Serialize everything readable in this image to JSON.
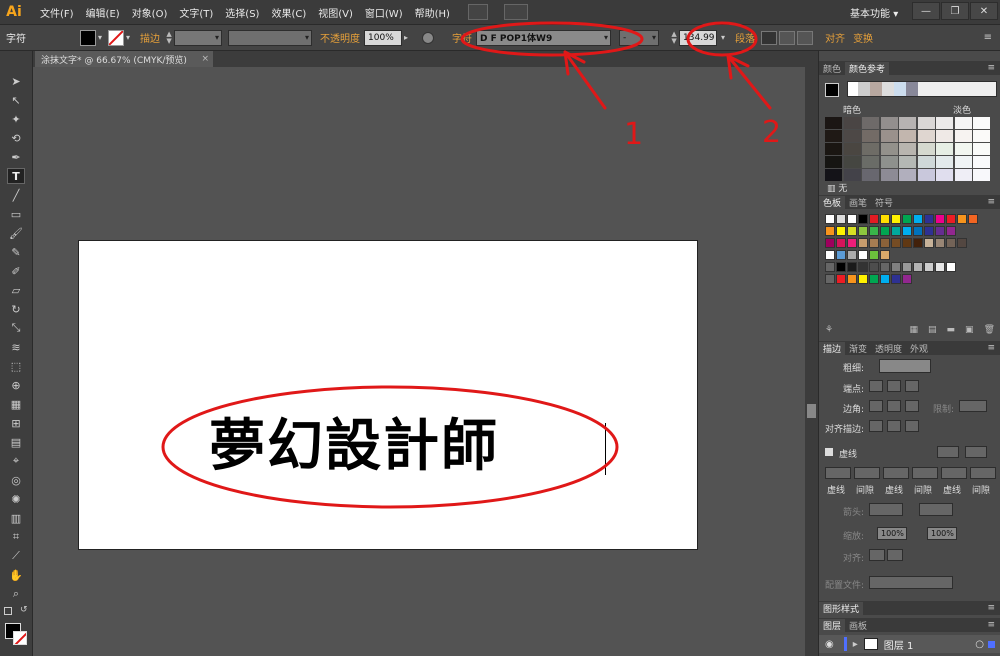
{
  "app": {
    "logo": "Ai",
    "workspace": "基本功能",
    "workspace_arrow": "▾"
  },
  "menu": [
    "文件(F)",
    "编辑(E)",
    "对象(O)",
    "文字(T)",
    "选择(S)",
    "效果(C)",
    "视图(V)",
    "窗口(W)",
    "帮助(H)"
  ],
  "window_controls": [
    "—",
    "❐",
    "✕"
  ],
  "control_bar": {
    "mode_label": "字符",
    "stroke_label": "描边",
    "opacity_label": "不透明度",
    "opacity_value": "100%",
    "char_label": "字符",
    "font_value": "D F POP1体W9",
    "font_style_value": "-",
    "font_size_value": "134.99",
    "para_label": "段落",
    "align_label": "对齐",
    "transform_label": "变换"
  },
  "document": {
    "tab_title": "涂抹文字* @ 66.67% (CMYK/预览)",
    "tab_close": "×",
    "art_text": "夢幻設計師"
  },
  "annotations": {
    "label_1": "1",
    "label_2": "2"
  },
  "colors": {
    "annotation_red": "#e01818",
    "accent": "#e6a03a"
  },
  "panels": {
    "color_tabs": [
      "颜色",
      "颜色参考"
    ],
    "dark_label": "暗色",
    "light_label": "淡色",
    "none_label": "无",
    "swatch_tabs": [
      "色板",
      "画笔",
      "符号"
    ],
    "stroke_tabs": [
      "描边",
      "渐变",
      "透明度",
      "外观"
    ],
    "weight_label": "粗细:",
    "cap_label": "端点:",
    "corner_label": "边角:",
    "limit_label": "限制:",
    "align_stroke_label": "对齐描边:",
    "dashed_label": "虚线",
    "dash_cols": [
      "虚线",
      "间隙",
      "虚线",
      "间隙",
      "虚线",
      "间隙"
    ],
    "arrow_label": "箭头:",
    "scale_label": "缩放:",
    "scale_values": [
      "100%",
      "100%"
    ],
    "align_label": "对齐:",
    "profile_label": "配置文件:",
    "graphic_styles_tab": "图形样式",
    "layer_tabs": [
      "图层",
      "画板"
    ],
    "layer_name": "图层 1"
  }
}
